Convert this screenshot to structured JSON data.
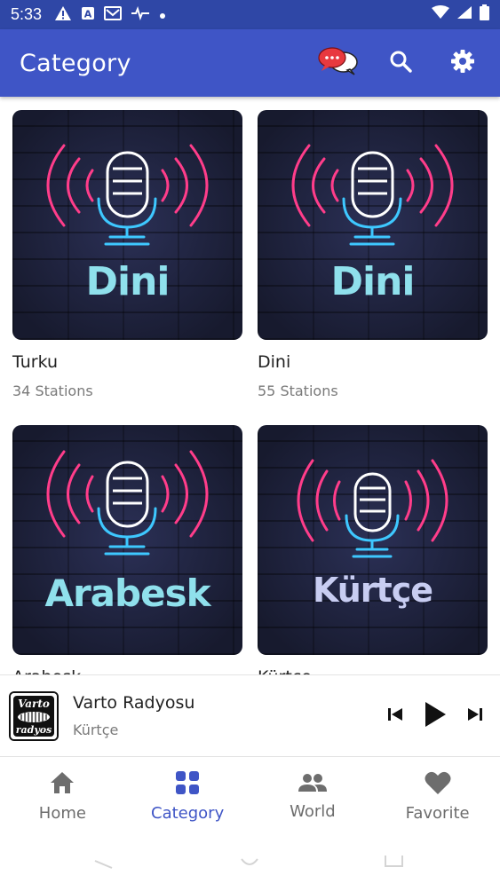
{
  "status_bar": {
    "time": "5:33",
    "icons_left": [
      "warning-icon",
      "app-a-icon",
      "gmail-icon",
      "activity-icon",
      "dot-icon"
    ],
    "icons_right": [
      "wifi-icon",
      "cell-signal-icon",
      "battery-icon"
    ]
  },
  "app_bar": {
    "title": "Category",
    "actions": [
      "chat-bubbles-icon",
      "search-icon",
      "settings-icon"
    ]
  },
  "categories": [
    {
      "name": "Turku",
      "count": "34 Stations",
      "thumb_text": "Dini"
    },
    {
      "name": "Dini",
      "count": "55 Stations",
      "thumb_text": "Dini"
    },
    {
      "name": "Arabesk",
      "count": "",
      "thumb_text": "Arabesk"
    },
    {
      "name": "Kürtçe",
      "count": "",
      "thumb_text": "Kürtçe"
    }
  ],
  "player": {
    "title": "Varto Radyosu",
    "subtitle": "Kürtçe",
    "logo_text_top": "Varto",
    "logo_text_bottom": "radyos"
  },
  "bottom_nav": {
    "items": [
      {
        "label": "Home",
        "icon": "home-icon",
        "active": false
      },
      {
        "label": "Category",
        "icon": "grid-icon",
        "active": true
      },
      {
        "label": "World",
        "icon": "people-icon",
        "active": false
      },
      {
        "label": "Favorite",
        "icon": "heart-icon",
        "active": false
      }
    ]
  },
  "colors": {
    "primary": "#3f55c6",
    "status_bar": "#2f47a6",
    "neon_pink": "#ff3d8a",
    "neon_blue": "#3ec8ff",
    "text_cyan": "#8fe0ec",
    "text_lavender": "#c8cdf2"
  }
}
